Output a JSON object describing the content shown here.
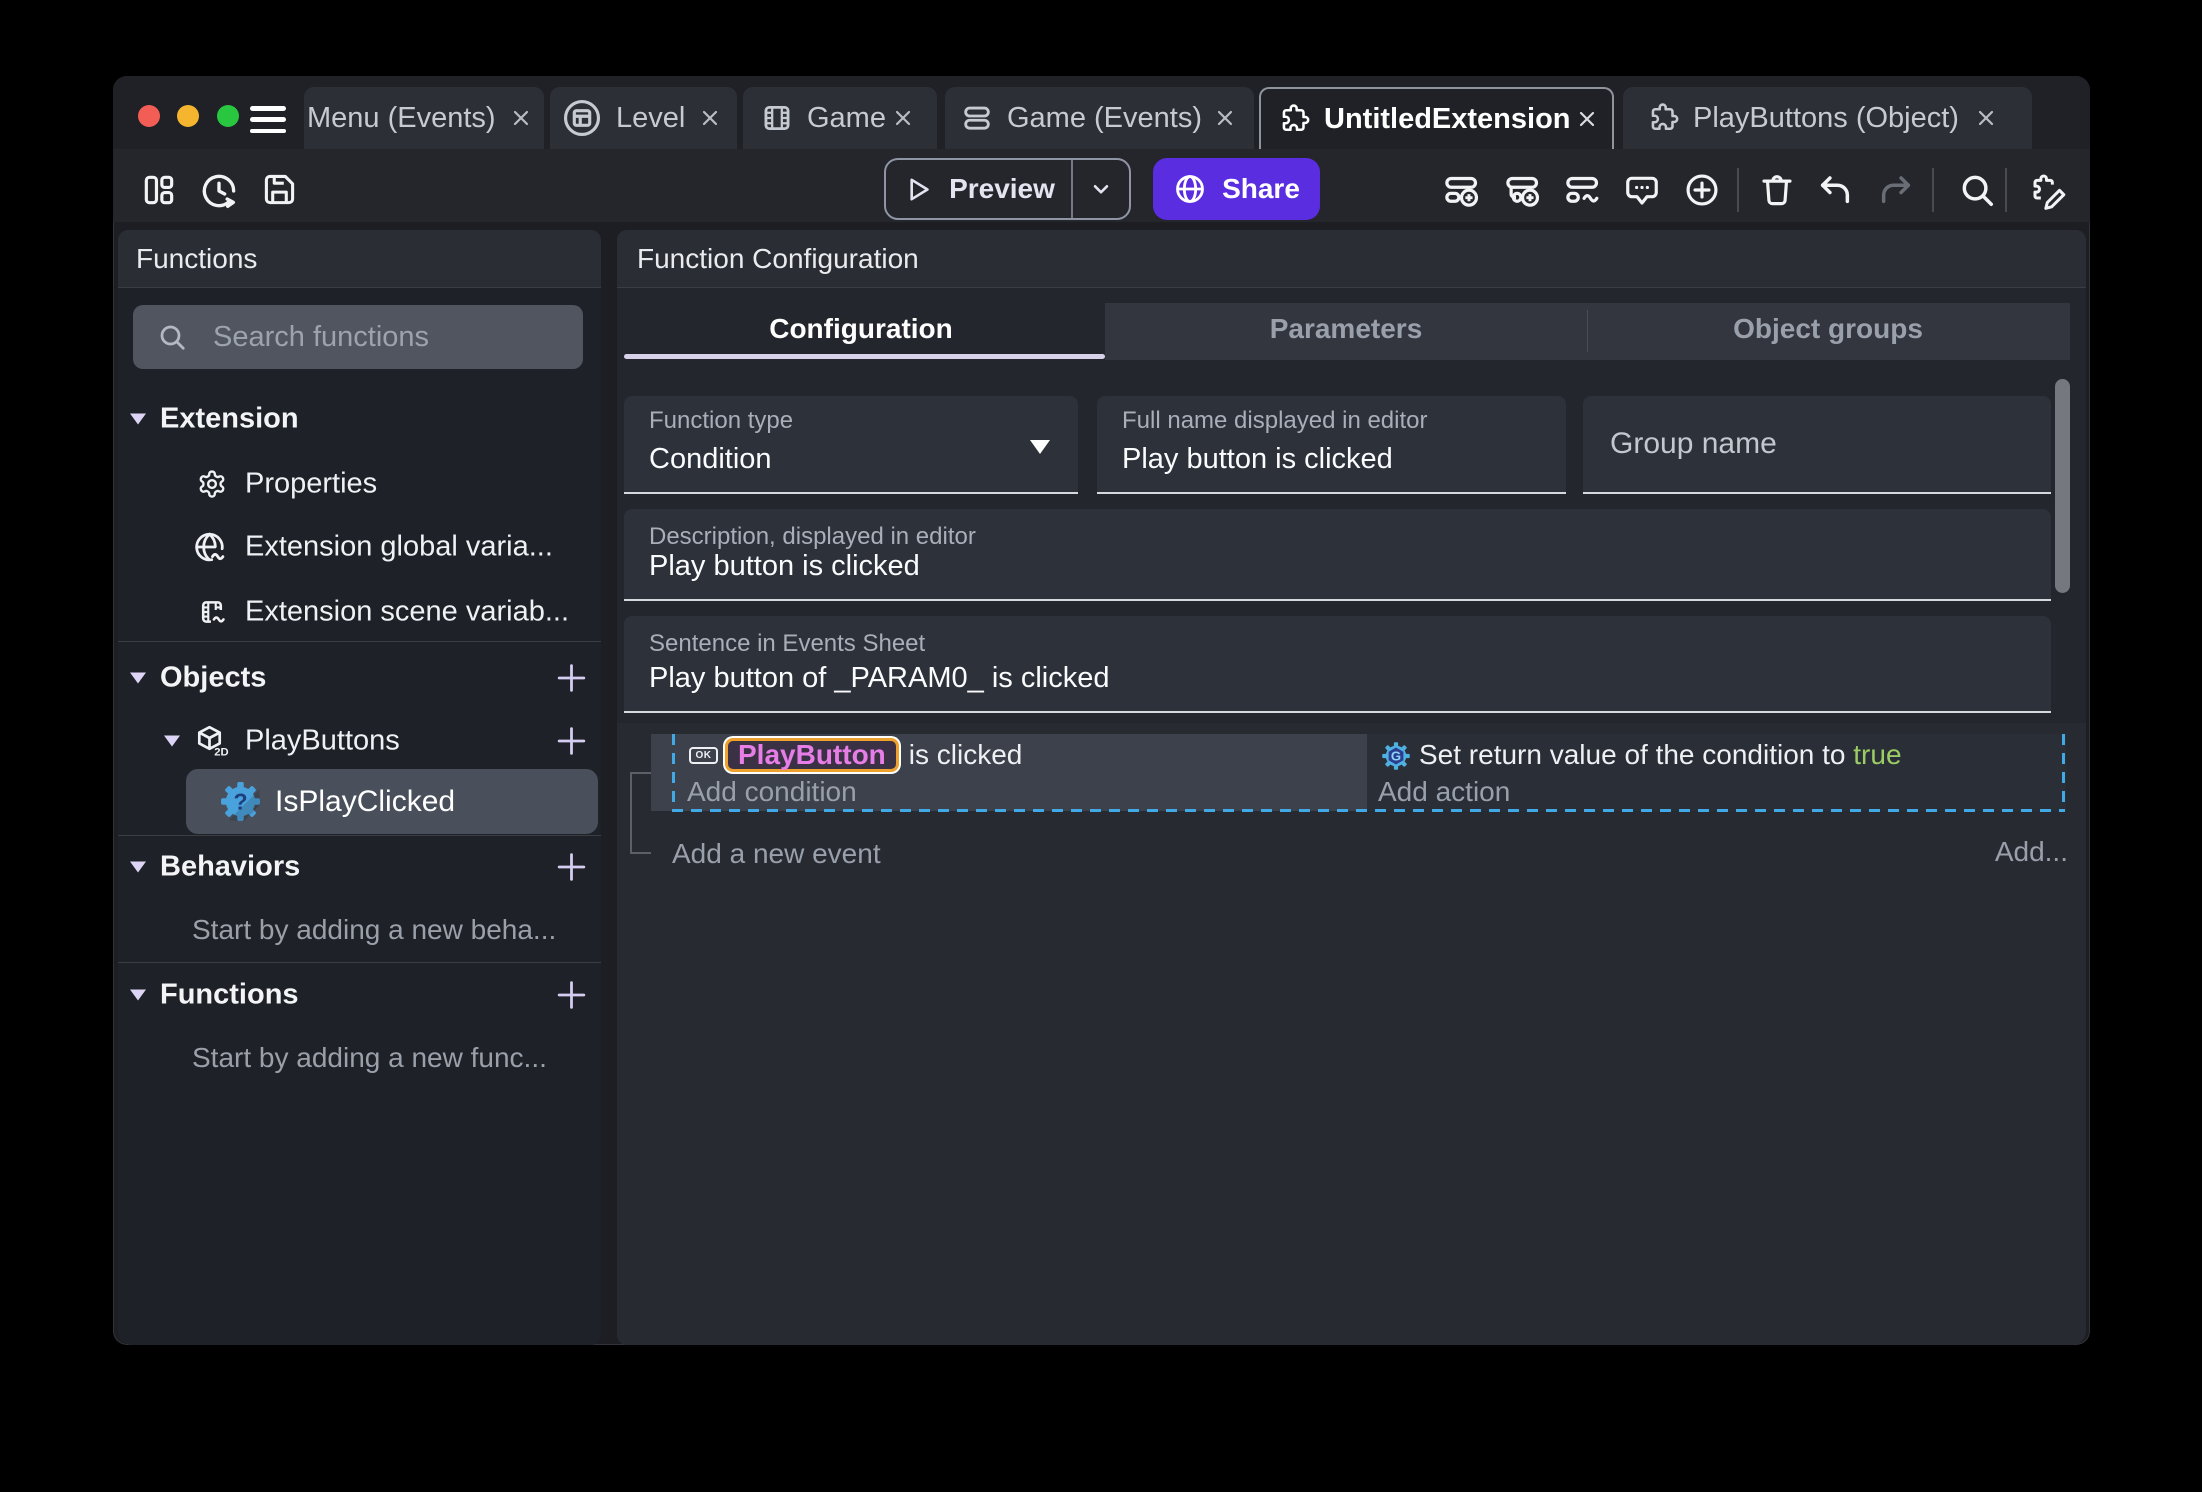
{
  "titlebar": {
    "tabs": [
      {
        "label": "Menu (Events)"
      },
      {
        "label": "Level"
      },
      {
        "label": "Game"
      },
      {
        "label": "Game (Events)"
      },
      {
        "label": "UntitledExtension"
      },
      {
        "label": "PlayButtons (Object)"
      }
    ]
  },
  "toolbar": {
    "preview_label": "Preview",
    "share_label": "Share"
  },
  "sidebar": {
    "title": "Functions",
    "search_placeholder": "Search functions",
    "extension_section": {
      "label": "Extension",
      "items": [
        {
          "label": "Properties"
        },
        {
          "label": "Extension global varia..."
        },
        {
          "label": "Extension scene variab..."
        }
      ]
    },
    "objects_section": {
      "label": "Objects",
      "object_label": "PlayButtons",
      "object_badge": "2D",
      "function_label": "IsPlayClicked"
    },
    "behaviors_section": {
      "label": "Behaviors",
      "empty_hint": "Start by adding a new beha..."
    },
    "functions_section": {
      "label": "Functions",
      "empty_hint": "Start by adding a new func..."
    }
  },
  "main": {
    "title": "Function Configuration",
    "tabs": [
      {
        "label": "Configuration"
      },
      {
        "label": "Parameters"
      },
      {
        "label": "Object groups"
      }
    ],
    "form": {
      "function_type_label": "Function type",
      "function_type_value": "Condition",
      "full_name_label": "Full name displayed in editor",
      "full_name_value": "Play button is clicked",
      "group_name_placeholder": "Group name",
      "description_label": "Description, displayed in editor",
      "description_value": "Play button is clicked",
      "sentence_label": "Sentence in Events Sheet",
      "sentence_value": "Play button of _PARAM0_ is clicked"
    },
    "events": {
      "condition_ok": "OK",
      "condition_object": "PlayButton",
      "condition_text": "is clicked",
      "add_condition": "Add condition",
      "action_text": "Set return value of the condition to",
      "action_value": "true",
      "add_action": "Add action",
      "add_new_event": "Add a new event",
      "add_more": "Add..."
    }
  },
  "colors": {
    "share_accent": "#5a2de0",
    "selection_dashed": "#41a9e5",
    "object_chip_text": "#e77de7",
    "object_chip_border": "#efa12d",
    "true_value_green": "#9ccc65",
    "function_icon_blue": "#4aa2dc"
  }
}
